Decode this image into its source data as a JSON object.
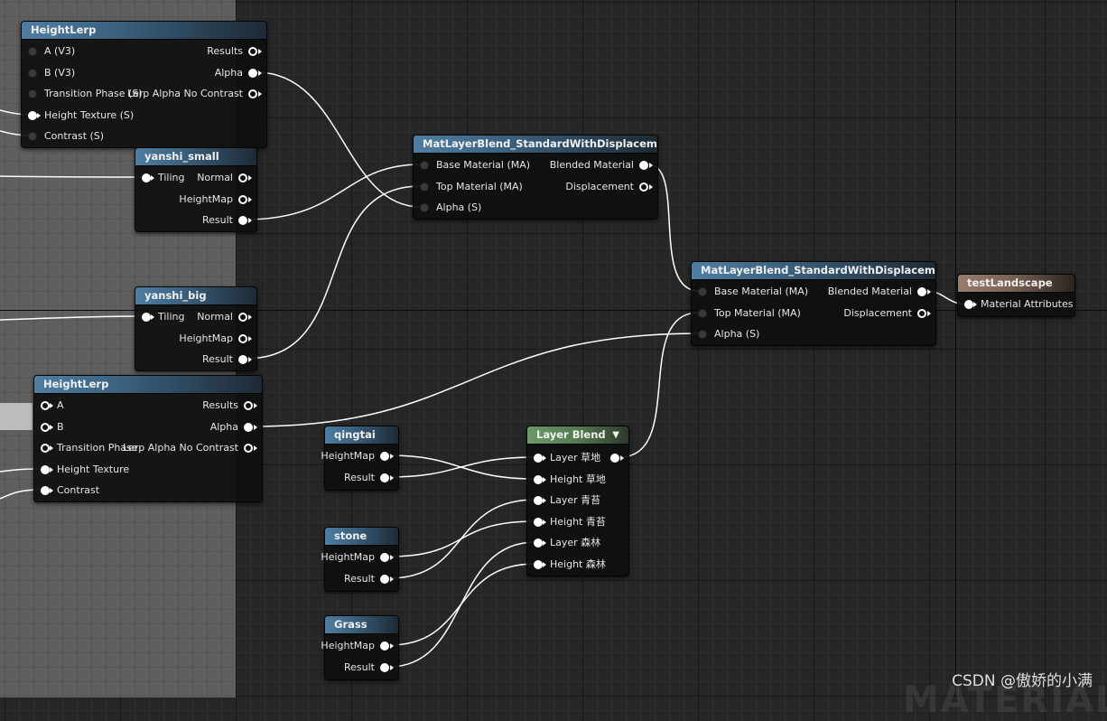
{
  "nodes": {
    "heightlerp1": {
      "title": "HeightLerp",
      "inputs": [
        "A (V3)",
        "B (V3)",
        "Transition Phase (S)",
        "Height Texture (S)",
        "Contrast (S)"
      ],
      "outputs": [
        "Results",
        "Alpha",
        "Lerp Alpha No Contrast"
      ]
    },
    "yanshi_small": {
      "title": "yanshi_small",
      "inputs": [
        "Tiling"
      ],
      "outputs": [
        "Normal",
        "HeightMap",
        "Result"
      ]
    },
    "yanshi_big": {
      "title": "yanshi_big",
      "inputs": [
        "Tiling"
      ],
      "outputs": [
        "Normal",
        "HeightMap",
        "Result"
      ]
    },
    "heightlerp2": {
      "title": "HeightLerp",
      "inputs": [
        "A",
        "B",
        "Transition Phase",
        "Height Texture",
        "Contrast"
      ],
      "outputs": [
        "Results",
        "Alpha",
        "Lerp Alpha No Contrast"
      ]
    },
    "blend1": {
      "title": "MatLayerBlend_StandardWithDisplacement",
      "inputs": [
        "Base Material (MA)",
        "Top Material (MA)",
        "Alpha (S)"
      ],
      "outputs": [
        "Blended Material",
        "Displacement"
      ]
    },
    "blend2": {
      "title": "MatLayerBlend_StandardWithDisplacement",
      "inputs": [
        "Base Material (MA)",
        "Top Material (MA)",
        "Alpha (S)"
      ],
      "outputs": [
        "Blended Material",
        "Displacement"
      ]
    },
    "testlandscape": {
      "title": "testLandscape",
      "inputs": [
        "Material Attributes"
      ]
    },
    "qingtai": {
      "title": "qingtai",
      "outputs": [
        "HeightMap",
        "Result"
      ]
    },
    "stone": {
      "title": "stone",
      "outputs": [
        "HeightMap",
        "Result"
      ]
    },
    "grass": {
      "title": "Grass",
      "outputs": [
        "HeightMap",
        "Result"
      ]
    },
    "layerblend": {
      "title": "Layer Blend",
      "inputs": [
        "Layer 草地",
        "Height 草地",
        "Layer 青苔",
        "Height 青苔",
        "Layer 森林",
        "Height 森林"
      ]
    }
  },
  "watermark": "CSDN @傲娇的小满",
  "background_text": "MATERIAL",
  "colors": {
    "graph_bg": "#262626",
    "comment_bg": "#5f5f5f",
    "title_blue": "#4f7ea2",
    "title_brown": "#9a7c6c",
    "title_green": "#6d9a6a",
    "wire": "#ffffff"
  }
}
